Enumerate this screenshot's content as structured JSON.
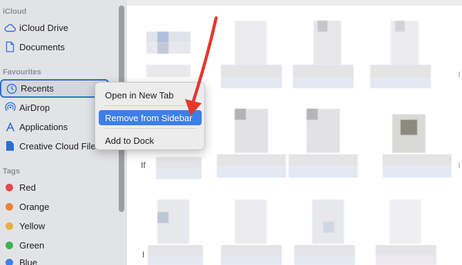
{
  "sidebar": {
    "icloud_header": "iCloud",
    "icloud_items": [
      {
        "label": "iCloud Drive",
        "icon": "cloud-icon"
      },
      {
        "label": "Documents",
        "icon": "document-icon"
      }
    ],
    "favourites_header": "Favourites",
    "favourites_items": [
      {
        "label": "Recents",
        "icon": "clock-icon",
        "selected": true
      },
      {
        "label": "AirDrop",
        "icon": "airdrop-icon"
      },
      {
        "label": "Applications",
        "icon": "applications-icon"
      },
      {
        "label": "Creative Cloud Files",
        "icon": "file-icon"
      }
    ],
    "tags_header": "Tags",
    "tags": [
      {
        "label": "Red",
        "color": "#e5484d"
      },
      {
        "label": "Orange",
        "color": "#e8823b"
      },
      {
        "label": "Yellow",
        "color": "#e4b23a"
      },
      {
        "label": "Green",
        "color": "#3fb24f"
      },
      {
        "label": "Blue",
        "color": "#3d7ee8"
      }
    ]
  },
  "context_menu": {
    "items": [
      {
        "label": "Open in New Tab",
        "highlighted": false
      },
      {
        "label": "Remove from Sidebar",
        "highlighted": true
      },
      {
        "label": "Add to Dock",
        "highlighted": false
      }
    ]
  },
  "main": {
    "stray_letters": [
      "If",
      "I"
    ]
  },
  "colors": {
    "accent": "#3d7ee8",
    "arrow": "#e5372c",
    "sidebar_bg": "#e2e3e6"
  }
}
